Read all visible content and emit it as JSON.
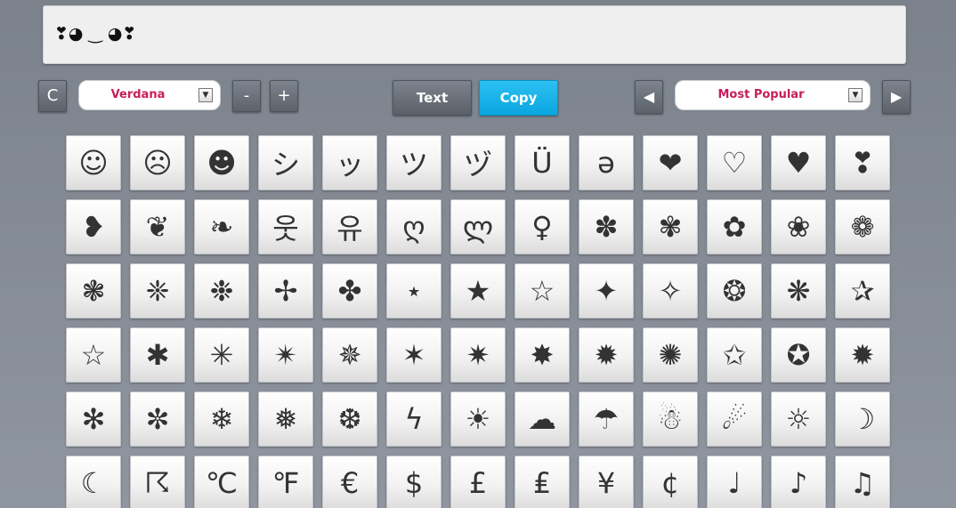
{
  "output": {
    "text": "❣◕ ‿ ◕❣"
  },
  "toolbar": {
    "clear_label": "C",
    "font_select": {
      "value": "Verdana",
      "arrow": "▼"
    },
    "minus_label": "-",
    "plus_label": "+",
    "text_label": "Text",
    "copy_label": "Copy",
    "prev_label": "◀",
    "category_select": {
      "value": "Most Popular",
      "arrow": "▼"
    },
    "next_label": "▶"
  },
  "symbols": [
    "☺",
    "☹",
    "☻",
    "シ",
    "ッ",
    "ツ",
    "ヅ",
    "Ü",
    "ǝ",
    "❤",
    "♡",
    "♥",
    "❣",
    "❥",
    "❦",
    "❧",
    "웃",
    "유",
    "ღ",
    "ლ",
    "♀",
    "✽",
    "✾",
    "✿",
    "❀",
    "❁",
    "❃",
    "❈",
    "❉",
    "✢",
    "✤",
    "⋆",
    "★",
    "☆",
    "✦",
    "✧",
    "❂",
    "❋",
    "✰",
    "☆",
    "✱",
    "✳",
    "✴",
    "✵",
    "✶",
    "✷",
    "✸",
    "✹",
    "✺",
    "✩",
    "✪",
    "✹",
    "✻",
    "✼",
    "❄",
    "❅",
    "❆",
    "ϟ",
    "☀",
    "☁",
    "☂",
    "☃",
    "☄",
    "☼",
    "☽",
    "☾",
    "☈",
    "℃",
    "℉",
    "€",
    "$",
    "£",
    "₤",
    "¥",
    "¢",
    "♩",
    "♪",
    "♫"
  ],
  "colors": {
    "accent": "#0aa6e0",
    "select_text": "#c81d5a",
    "background": "#868d97"
  }
}
